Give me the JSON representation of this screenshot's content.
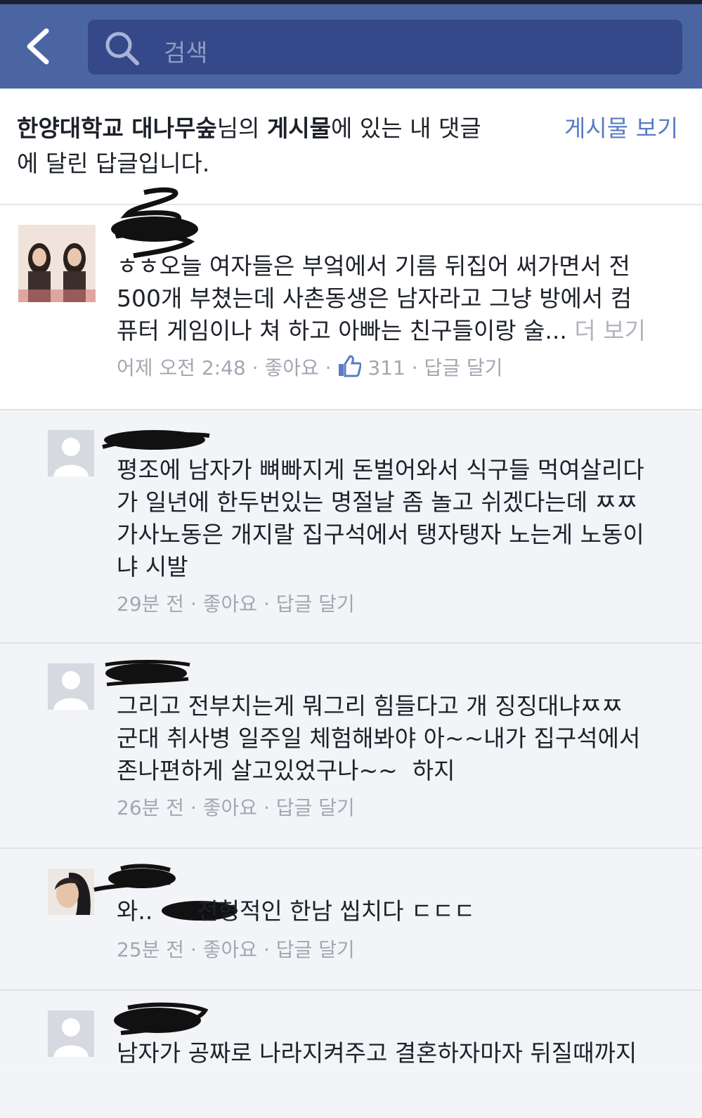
{
  "nav": {
    "search_placeholder": "검색"
  },
  "header": {
    "notice_parts": [
      "한양대학교 대나무숲",
      "님의 ",
      "게시물",
      "에 있는 내 댓글",
      "에 달린 답글입니다."
    ],
    "view_post_label": "게시물 보기"
  },
  "comment": {
    "lines": [
      "ㅎㅎ오늘 여자들은 부엌에서 기름 뒤집어 써가면서 전",
      "500개 부쳤는데 사촌동생은 남자라고 그냥 방에서 컴",
      "퓨터 게임이나 쳐 하고 아빠는 친구들이랑 술..."
    ],
    "see_more": "더 보기",
    "time": "어제 오전 2:48",
    "sep": "·",
    "like": "좋아요",
    "like_count": "311",
    "reply": "답글 달기"
  },
  "replies": [
    {
      "lines": [
        "평조에 남자가 뼈빠지게 돈벌어와서 식구들 먹여살리다",
        "가 일년에 한두번있는 명절날 좀 놀고 쉬겠다는데 ㅉㅉ",
        "가사노동은 개지랄 집구석에서 탱자탱자 노는게 노동이",
        "냐 시발"
      ],
      "time": "29분 전",
      "like": "좋아요",
      "reply": "답글 달기"
    },
    {
      "lines": [
        "그리고 전부치는게 뭐그리 힘들다고 개 징징대냐ㅉㅉ",
        "군대 취사병 일주일 체험해봐야 아~~내가 집구석에서",
        "존나편하게 살고있었구나~~  하지"
      ],
      "time": "26분 전",
      "like": "좋아요",
      "reply": "답글 달기"
    },
    {
      "lines": [
        "와..      전형적인 한남 씹치다 ㄷㄷㄷ"
      ],
      "time": "25분 전",
      "like": "좋아요",
      "reply": "답글 달기"
    },
    {
      "lines": [
        "남자가 공짜로 나라지켜주고 결혼하자마자 뒤질때까지"
      ]
    }
  ]
}
